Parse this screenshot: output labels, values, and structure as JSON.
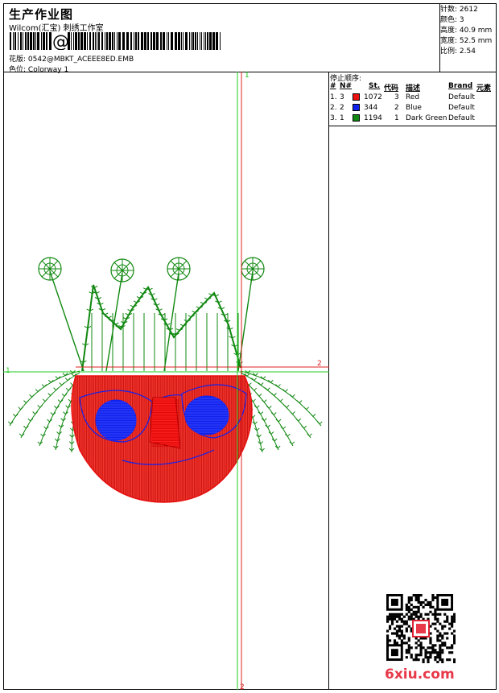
{
  "header": {
    "title": "生产作业图",
    "company": "Wilcom(汇宝) 刺绣工作室",
    "design_label": "花版:",
    "design_file": "0542@MBKT_ACEEE8ED.EMB",
    "colorway_label": "色位:",
    "colorway": "Colorway 1"
  },
  "stats": {
    "stitches": "针数: 2612",
    "colors": "颜色: 3",
    "height": "高度: 40.9 mm",
    "width": "宽度: 52.5 mm",
    "scale": "比例: 2.54"
  },
  "stop_sequence": {
    "heading": "停止顺序:",
    "columns": {
      "num": "#",
      "n": "N#",
      "st": "St.",
      "code": "代码",
      "desc": "描述",
      "brand": "Brand",
      "element": "元素"
    },
    "rows": [
      {
        "num": "1.",
        "n": "3",
        "color": "#ee1111",
        "st": "1072",
        "code": "3",
        "desc": "Red",
        "brand": "Default"
      },
      {
        "num": "2.",
        "n": "2",
        "color": "#1122ee",
        "st": "344",
        "code": "2",
        "desc": "Blue",
        "brand": "Default"
      },
      {
        "num": "3.",
        "n": "1",
        "color": "#118811",
        "st": "1194",
        "code": "1",
        "desc": "Dark Green",
        "brand": "Default"
      }
    ]
  },
  "axes": {
    "h_left": "1",
    "h_right": "2",
    "v_top": "1",
    "v_bottom": "2"
  },
  "watermark": "6xiu.com",
  "colors": {
    "red": "#ee1111",
    "blue": "#1122ee",
    "green": "#118811",
    "axis_green": "#22cc22",
    "axis_red": "#dd2222"
  }
}
